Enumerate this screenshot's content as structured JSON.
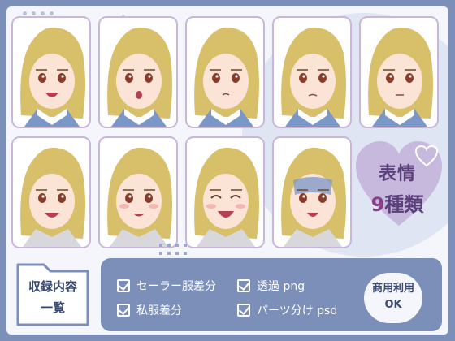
{
  "colors": {
    "frame": "#7b8fb8",
    "background": "#f4f6fb",
    "tile_border": "#c9b6d9",
    "heart": "#c6b9dd",
    "hair": "#d8bf6a",
    "skin": "#fbe4d6",
    "collar": "#7b97c7"
  },
  "tiles": [
    {
      "expression": "smile-open"
    },
    {
      "expression": "surprised"
    },
    {
      "expression": "pout"
    },
    {
      "expression": "worried"
    },
    {
      "expression": "troubled"
    },
    {
      "expression": "angry"
    },
    {
      "expression": "blush-embarrassed"
    },
    {
      "expression": "laughing-closed-eyes"
    },
    {
      "expression": "shocked-pale"
    }
  ],
  "heart": {
    "line1": "表情",
    "count": "9",
    "unit": "種類"
  },
  "folder": {
    "line1": "収録内容",
    "line2": "一覧"
  },
  "features": [
    "セーラー服差分",
    "透過 png",
    "私服差分",
    "パーツ分け psd"
  ],
  "badge": {
    "line1": "商用利用",
    "line2": "OK"
  }
}
